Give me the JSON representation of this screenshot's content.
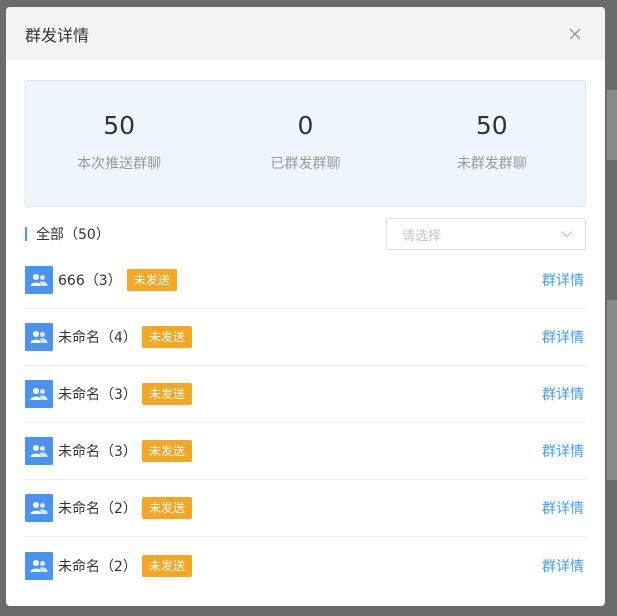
{
  "dialog": {
    "title": "群发详情"
  },
  "stats": [
    {
      "value": "50",
      "label": "本次推送群聊"
    },
    {
      "value": "0",
      "label": "已群发群聊"
    },
    {
      "value": "50",
      "label": "未群发群聊"
    }
  ],
  "filter": {
    "title": "全部（50）",
    "placeholder": "请选择"
  },
  "groups": [
    {
      "name": "666（3）",
      "status": "未发送",
      "action": "群详情"
    },
    {
      "name": "未命名（4）",
      "status": "未发送",
      "action": "群详情"
    },
    {
      "name": "未命名（3）",
      "status": "未发送",
      "action": "群详情"
    },
    {
      "name": "未命名（3）",
      "status": "未发送",
      "action": "群详情"
    },
    {
      "name": "未命名（2）",
      "status": "未发送",
      "action": "群详情"
    },
    {
      "name": "未命名（2）",
      "status": "未发送",
      "action": "群详情"
    }
  ],
  "colors": {
    "accent": "#409eff",
    "badge": "#f5a623",
    "avatar": "#4a93f0",
    "stats_bg": "#eef5fd"
  },
  "icons": {
    "close": "close-icon",
    "dropdown": "chevron-down-icon",
    "avatar": "group-avatar-icon"
  }
}
